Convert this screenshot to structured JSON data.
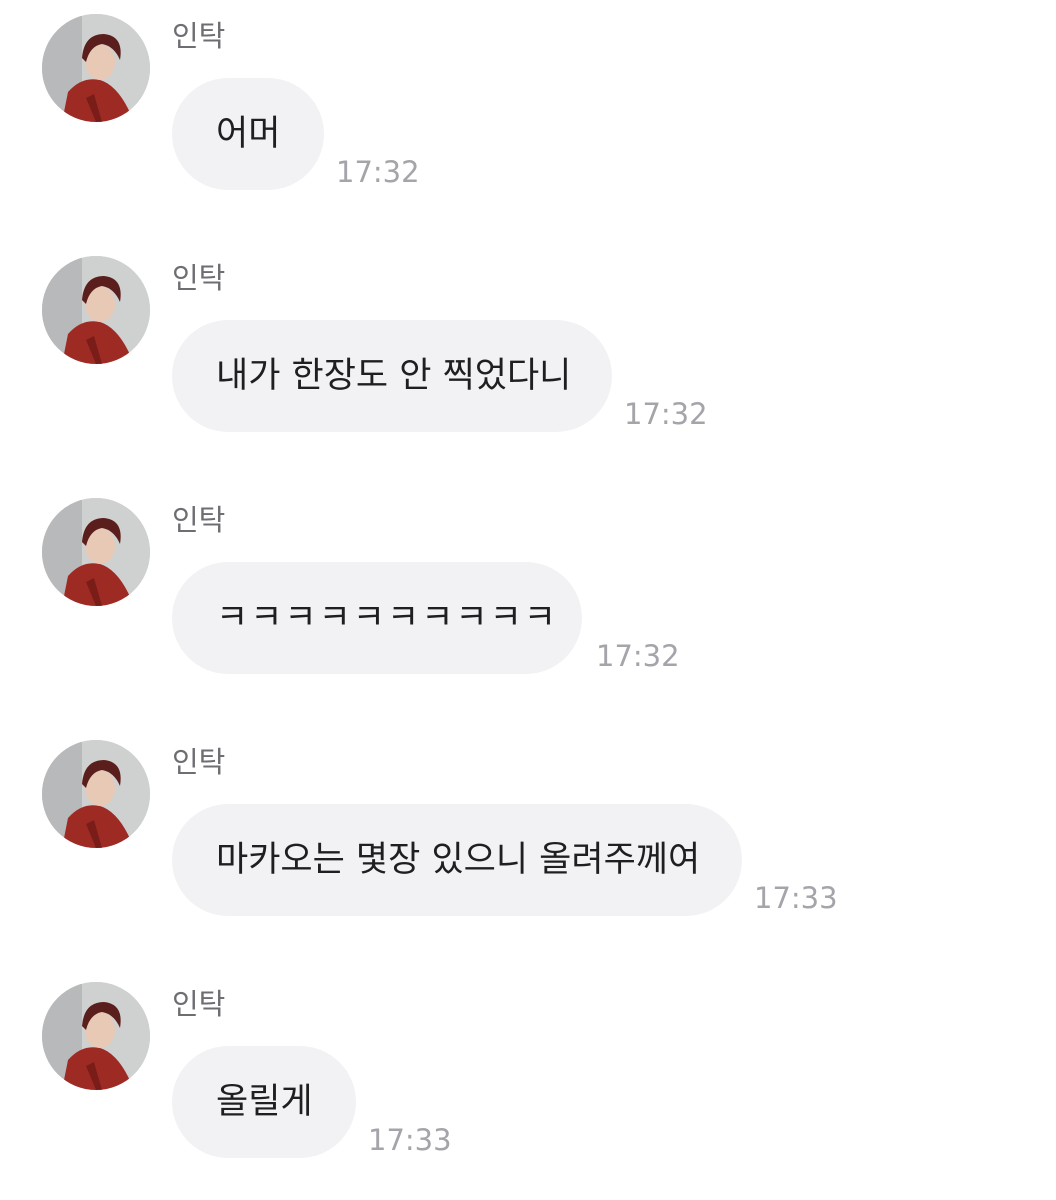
{
  "messages": [
    {
      "sender": "인탁",
      "text": "어머",
      "time": "17:32"
    },
    {
      "sender": "인탁",
      "text": "내가 한장도 안 찍었다니",
      "time": "17:32"
    },
    {
      "sender": "인탁",
      "text": "ㅋㅋㅋㅋㅋㅋㅋㅋㅋㅋ",
      "time": "17:32"
    },
    {
      "sender": "인탁",
      "text": "마카오는 몇장 있으니 올려주께여",
      "time": "17:33"
    },
    {
      "sender": "인탁",
      "text": "올릴게",
      "time": "17:33"
    }
  ],
  "avatar_icon": "profile-photo-icon",
  "colors": {
    "background": "#ffffff",
    "bubble": "#f2f2f5",
    "text": "#1f1f1f",
    "sender": "#6d6d72",
    "time": "#a4a4aa"
  }
}
